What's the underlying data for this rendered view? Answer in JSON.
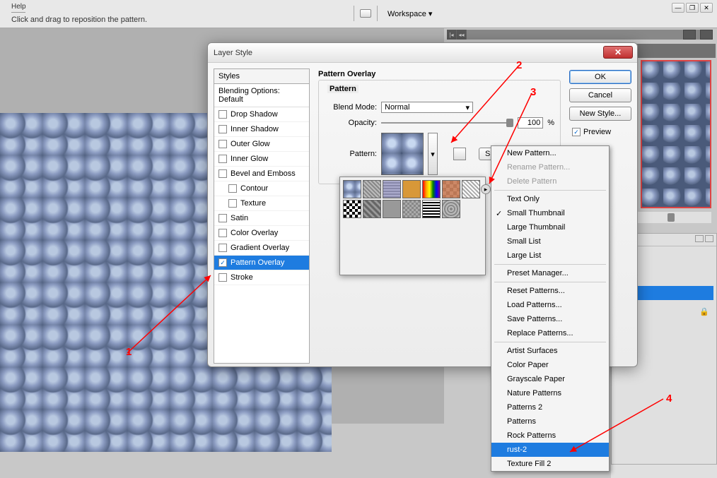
{
  "help": "Help",
  "hint": "Click and drag to reposition the pattern.",
  "workspace": "Workspace ▾",
  "dialog": {
    "title": "Layer Style",
    "styles_header": "Styles",
    "blending_options": "Blending Options: Default",
    "items": [
      {
        "label": "Drop Shadow",
        "checked": false
      },
      {
        "label": "Inner Shadow",
        "checked": false
      },
      {
        "label": "Outer Glow",
        "checked": false
      },
      {
        "label": "Inner Glow",
        "checked": false
      },
      {
        "label": "Bevel and Emboss",
        "checked": false
      },
      {
        "label": "Contour",
        "checked": false,
        "indent": true
      },
      {
        "label": "Texture",
        "checked": false,
        "indent": true
      },
      {
        "label": "Satin",
        "checked": false
      },
      {
        "label": "Color Overlay",
        "checked": false
      },
      {
        "label": "Gradient Overlay",
        "checked": false
      },
      {
        "label": "Pattern Overlay",
        "checked": true,
        "selected": true
      },
      {
        "label": "Stroke",
        "checked": false
      }
    ],
    "panel_title": "Pattern Overlay",
    "group_legend": "Pattern",
    "blend_mode_label": "Blend Mode:",
    "blend_mode_value": "Normal",
    "opacity_label": "Opacity:",
    "opacity_value": "100",
    "pct": "%",
    "pattern_label": "Pattern:",
    "snap_btn": "Snap to",
    "ok": "OK",
    "cancel": "Cancel",
    "new_style": "New Style...",
    "preview": "Preview"
  },
  "context_menu": {
    "items": [
      {
        "label": "New Pattern..."
      },
      {
        "label": "Rename Pattern...",
        "disabled": true
      },
      {
        "label": "Delete Pattern",
        "disabled": true
      },
      {
        "sep": true
      },
      {
        "label": "Text Only"
      },
      {
        "label": "Small Thumbnail",
        "check": true
      },
      {
        "label": "Large Thumbnail"
      },
      {
        "label": "Small List"
      },
      {
        "label": "Large List"
      },
      {
        "sep": true
      },
      {
        "label": "Preset Manager..."
      },
      {
        "sep": true
      },
      {
        "label": "Reset Patterns..."
      },
      {
        "label": "Load Patterns..."
      },
      {
        "label": "Save Patterns..."
      },
      {
        "label": "Replace Patterns..."
      },
      {
        "sep": true
      },
      {
        "label": "Artist Surfaces"
      },
      {
        "label": "Color Paper"
      },
      {
        "label": "Grayscale Paper"
      },
      {
        "label": "Nature Patterns"
      },
      {
        "label": "Patterns 2"
      },
      {
        "label": "Patterns"
      },
      {
        "label": "Rock Patterns"
      },
      {
        "label": "rust-2",
        "selected": true
      },
      {
        "label": "Texture Fill 2"
      }
    ]
  },
  "annotations": {
    "a1": "1",
    "a2": "2",
    "a3": "3",
    "a4": "4"
  }
}
